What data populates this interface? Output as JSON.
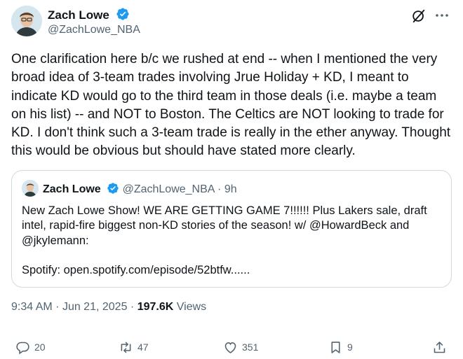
{
  "author": {
    "name": "Zach Lowe",
    "handle": "@ZachLowe_NBA",
    "verified": true
  },
  "tweet": {
    "text": "One clarification here b/c we rushed at end -- when I mentioned the very broad idea of 3-team trades involving Jrue Holiday + KD, I meant to indicate KD would go to the third team in those deals (i.e. maybe a team on his list) -- and NOT to Boston. The Celtics are NOT looking to trade for KD. I don't think such a 3-team trade is really in the ether anyway. Thought this would be obvious but should have stated more clearly."
  },
  "quote": {
    "name": "Zach Lowe",
    "handle": "@ZachLowe_NBA",
    "separator": "·",
    "time": "9h",
    "text": "New Zach Lowe Show! WE ARE GETTING GAME 7!!!!!! Plus Lakers sale, draft intel, rapid-fire biggest non-KD stories of the season! w/ @HowardBeck and @jkylemann:\n\nSpotify: open.spotify.com/episode/52btfw......"
  },
  "meta": {
    "time": "9:34 AM",
    "separator": "·",
    "date": "Jun 21, 2025",
    "views_count": "197.6K",
    "views_label": "Views"
  },
  "actions": {
    "replies": "20",
    "reposts": "47",
    "likes": "351",
    "bookmarks": "9"
  },
  "icons": {
    "verified": "verified-badge-icon",
    "grok": "grok-icon",
    "more": "more-icon",
    "reply": "reply-icon",
    "repost": "repost-icon",
    "like": "heart-icon",
    "bookmark": "bookmark-icon",
    "share": "share-icon"
  },
  "colors": {
    "text": "#0f1419",
    "secondary": "#536471",
    "verified": "#1d9bf0",
    "border": "#cfd9de"
  }
}
